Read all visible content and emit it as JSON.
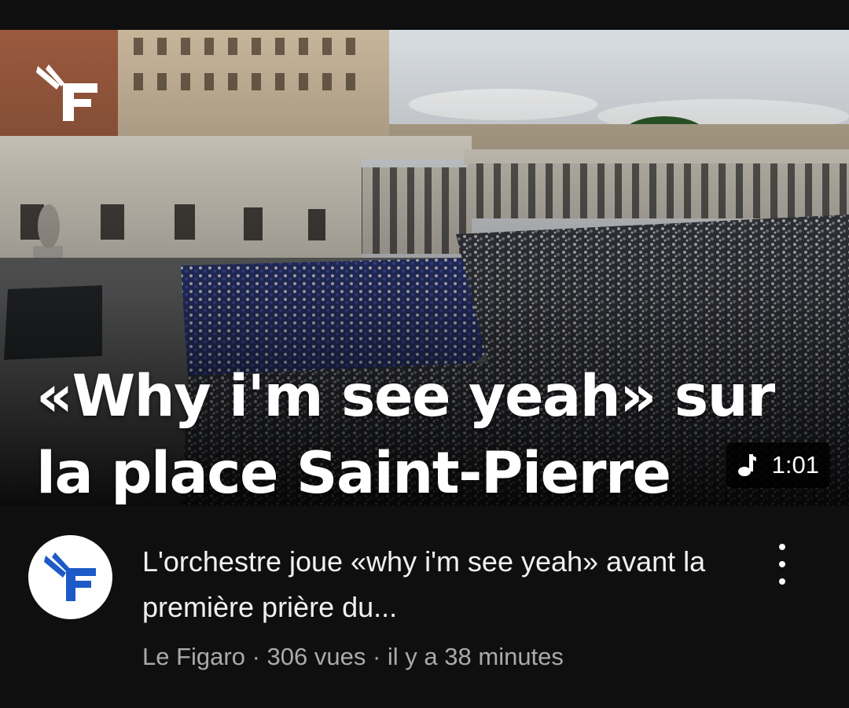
{
  "video": {
    "thumbnail_headline": "«Why i'm see yeah» sur la place Saint-Pierre",
    "duration": "1:01",
    "duration_icon": "music-note-icon",
    "title": "L'orchestre joue «why i'm see yeah» avant la première prière du...",
    "channel": "Le Figaro",
    "separator": " · ",
    "views": "306 vues",
    "age": "il y a 38 minutes",
    "more_icon": "vertical-dots-icon"
  },
  "colors": {
    "background": "#0f0f0f",
    "title_text": "#f1f1f1",
    "meta_text": "#aaaaaa",
    "figaro_blue": "#1d5ac8"
  }
}
